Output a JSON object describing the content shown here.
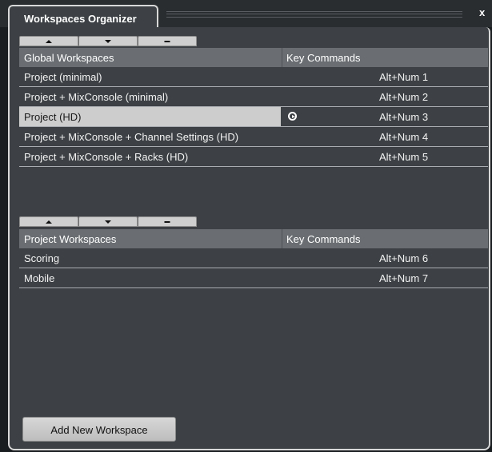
{
  "window": {
    "title": "Workspaces Organizer",
    "close_label": "x"
  },
  "global": {
    "header": {
      "name": "Global Workspaces",
      "keys": "Key Commands"
    },
    "rows": [
      {
        "name": "Project (minimal)",
        "key": "Alt+Num 1"
      },
      {
        "name": "Project + MixConsole (minimal)",
        "key": "Alt+Num 2"
      },
      {
        "name": "Project (HD)",
        "key": "Alt+Num 3",
        "selected": true,
        "active": true
      },
      {
        "name": "Project + MixConsole + Channel Settings (HD)",
        "key": "Alt+Num 4"
      },
      {
        "name": "Project + MixConsole + Racks (HD)",
        "key": "Alt+Num 5"
      }
    ]
  },
  "project": {
    "header": {
      "name": "Project Workspaces",
      "keys": "Key Commands"
    },
    "rows": [
      {
        "name": "Scoring",
        "key": "Alt+Num 6"
      },
      {
        "name": "Mobile",
        "key": "Alt+Num 7"
      }
    ]
  },
  "toolbar_icons": [
    "move-up-icon",
    "move-down-icon",
    "remove-icon"
  ],
  "add_button_label": "Add New Workspace",
  "colors": {
    "panel": "#3d4145",
    "header": "#6a6e72",
    "selection": "#cdcdcd",
    "button": "#cfcfcf"
  }
}
